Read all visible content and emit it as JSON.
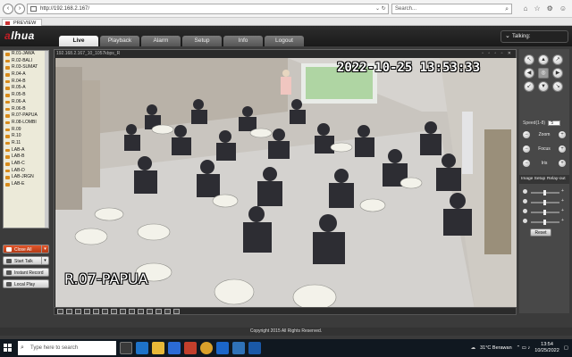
{
  "browser": {
    "url": "http://192.168.2.167/",
    "search_placeholder": "Search...",
    "tab_title": "PREVIEW"
  },
  "header": {
    "logo": "alhua",
    "menu": [
      {
        "label": "Live",
        "active": true
      },
      {
        "label": "Playback",
        "active": false
      },
      {
        "label": "Alarm",
        "active": false
      },
      {
        "label": "Setup",
        "active": false
      },
      {
        "label": "Info",
        "active": false
      },
      {
        "label": "Logout",
        "active": false
      }
    ],
    "talking_label": "Talking:"
  },
  "channels": [
    "R.01-JAWA",
    "R.02-BALI",
    "R.03-SUMAT",
    "R.04-A",
    "R.04-B",
    "R.05-A",
    "R.05-B",
    "R.06-A",
    "R.06-B",
    "R.07-PAPUA",
    "R.08-LOMBI",
    "R.09",
    "R.10",
    "R.11",
    "LAB-A",
    "LAB-B",
    "LAB-C",
    "LAB-D",
    "LAB-JRGN",
    "LAB-E"
  ],
  "left_buttons": {
    "close_all": "Close All",
    "start_talk": "Start Talk",
    "instant_record": "Instant Record",
    "local_play": "Local Play"
  },
  "video": {
    "title_bar": "192.168.2.167_10_1057kbps_R",
    "osd_time": "2022-10-25 13:53:33",
    "osd_name": "R.07-PAPUA"
  },
  "ptz": {
    "speed_label": "Speed(1-8)",
    "speed_value": "5",
    "zoom_label": "Zoom",
    "focus_label": "Focus",
    "iris_label": "Iris",
    "image_setup_label": "Image Setup",
    "relay_out_label": "Relay-out",
    "reset_label": "Reset"
  },
  "footer": {
    "copyright": "Copyright 2015 All Rights Reserved."
  },
  "taskbar": {
    "search_placeholder": "Type here to search",
    "weather": "31°C Berawan",
    "time": "13:54",
    "date": "10/25/2022"
  }
}
